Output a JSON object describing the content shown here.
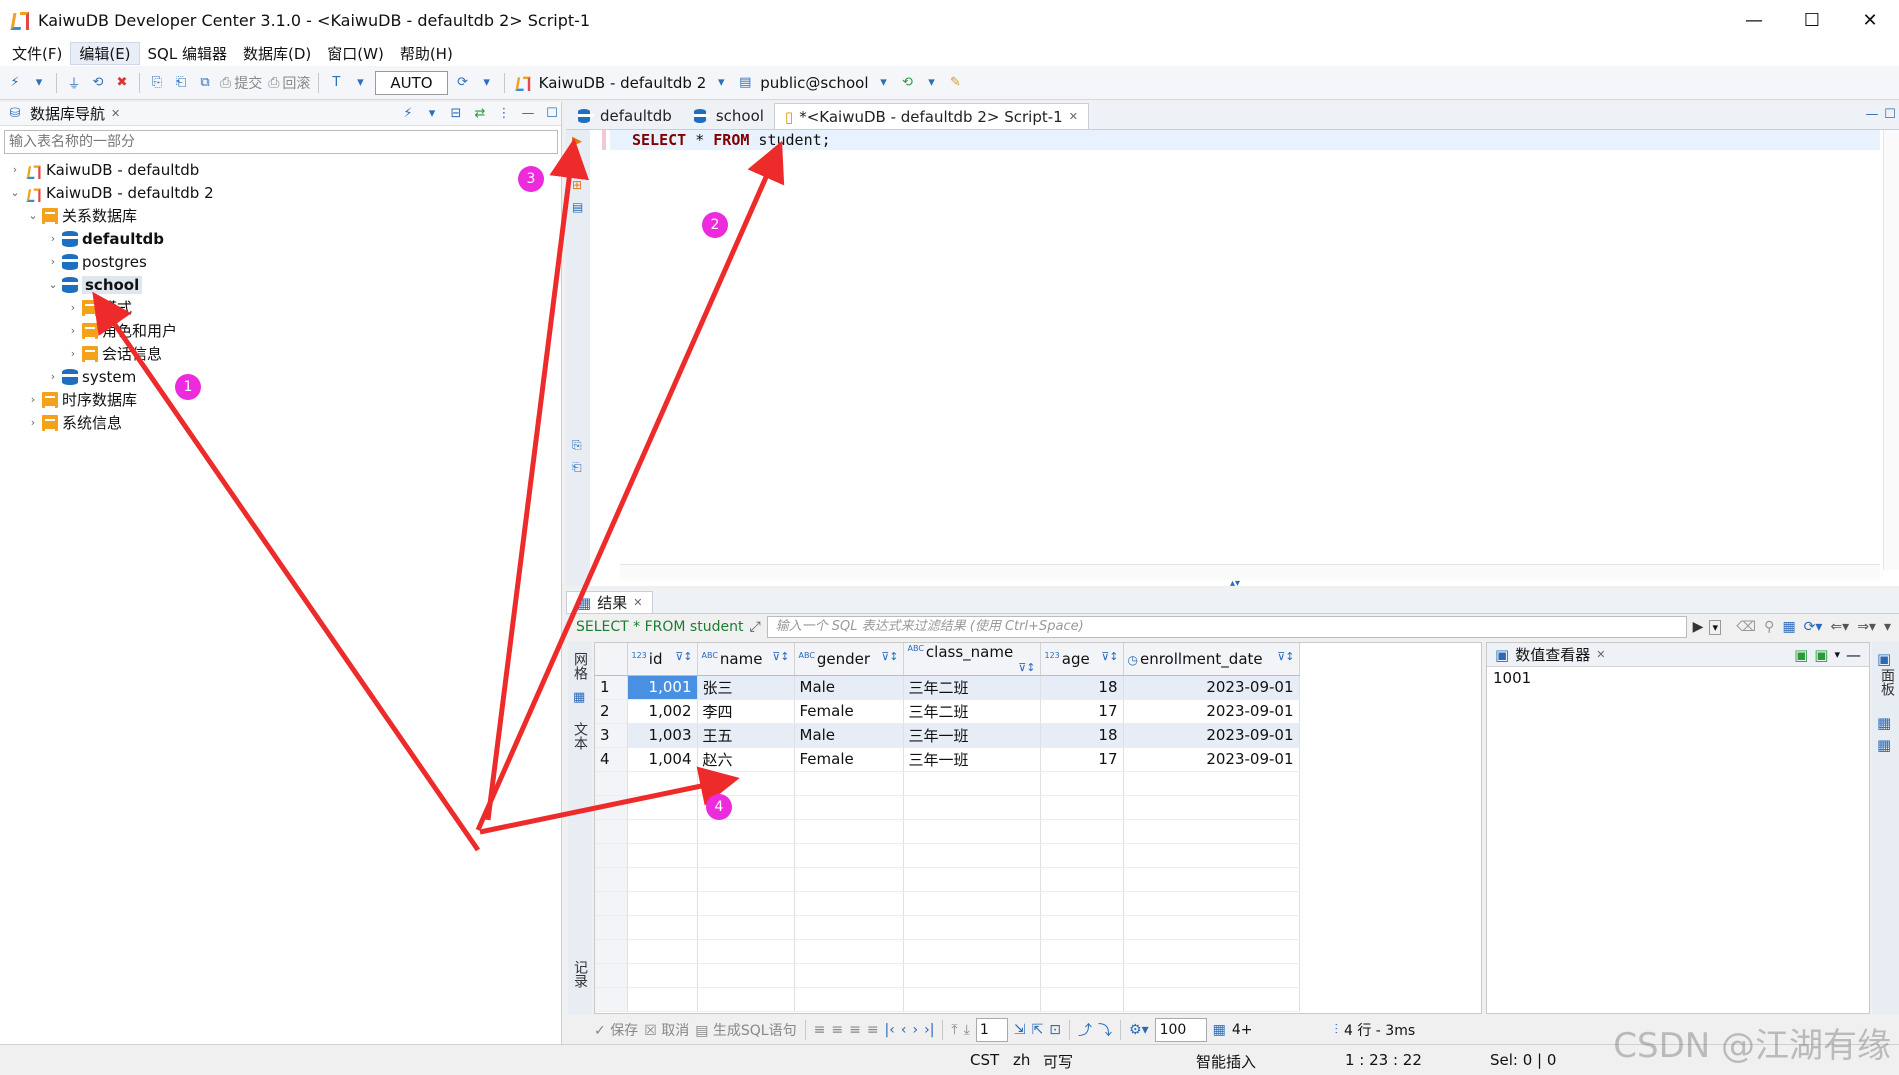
{
  "window": {
    "title": "KaiwuDB Developer Center 3.1.0 - <KaiwuDB - defaultdb 2> Script-1",
    "min": "—",
    "max": "☐",
    "close": "✕"
  },
  "menu": [
    "文件(F)",
    "编辑(E)",
    "SQL 编辑器",
    "数据库(D)",
    "窗口(W)",
    "帮助(H)"
  ],
  "toolbar": {
    "commit": "提交",
    "rollback": "回滚",
    "mode": "AUTO",
    "connection": "KaiwuDB - defaultdb 2",
    "schema": "public@school"
  },
  "navigator": {
    "title": "数据库导航",
    "filter_placeholder": "输入表名称的一部分",
    "nodes": {
      "conn1": "KaiwuDB - defaultdb",
      "conn2": "KaiwuDB - defaultdb 2",
      "relational": "关系数据库",
      "defaultdb": "defaultdb",
      "postgres": "postgres",
      "school": "school",
      "schema": "模式",
      "roles": "角色和用户",
      "sessions": "会话信息",
      "system": "system",
      "timeseries": "时序数据库",
      "sysinfo": "系统信息"
    }
  },
  "editor": {
    "tabs": [
      "defaultdb",
      "school",
      "*<KaiwuDB - defaultdb 2> Script-1"
    ],
    "sql": {
      "k1": "SELECT",
      "star": " * ",
      "k2": "FROM",
      "rest": " student;"
    }
  },
  "results": {
    "tab": "结果",
    "query": "SELECT * FROM student",
    "filter_hint": "输入一个 SQL 表达式来过滤结果 (使用 Ctrl+Space)",
    "columns": [
      {
        "type": "123",
        "name": "id"
      },
      {
        "type": "ABC",
        "name": "name"
      },
      {
        "type": "ABC",
        "name": "gender"
      },
      {
        "type": "ABC",
        "name": "class_name"
      },
      {
        "type": "123",
        "name": "age"
      },
      {
        "type": "◷",
        "name": "enrollment_date"
      }
    ],
    "rows": [
      [
        "1",
        "1,001",
        "张三",
        "Male",
        "三年二班",
        "18",
        "2023-09-01"
      ],
      [
        "2",
        "1,002",
        "李四",
        "Female",
        "三年二班",
        "17",
        "2023-09-01"
      ],
      [
        "3",
        "1,003",
        "王五",
        "Male",
        "三年一班",
        "18",
        "2023-09-01"
      ],
      [
        "4",
        "1,004",
        "赵六",
        "Female",
        "三年一班",
        "17",
        "2023-09-01"
      ]
    ],
    "side_grid": "网格",
    "side_text": "文本",
    "side_record": "记录"
  },
  "value_viewer": {
    "title": "数值查看器",
    "value": "1001",
    "side": "面板"
  },
  "bottom": {
    "save": "保存",
    "cancel": "取消",
    "gen_sql": "生成SQL语句",
    "page": "1",
    "fetch": "100",
    "count": "4+",
    "stats": "4 行 - 3ms"
  },
  "status": {
    "tz": "CST",
    "lang": "zh",
    "rw": "可写",
    "insert": "智能插入",
    "pos": "1 : 23 : 22",
    "sel": "Sel: 0 | 0"
  },
  "watermark": "CSDN @江湖有缘",
  "badges": [
    "1",
    "2",
    "3",
    "4"
  ],
  "colors": {
    "arrow": "#ee2b2b",
    "badge": "#ec2bdc"
  }
}
